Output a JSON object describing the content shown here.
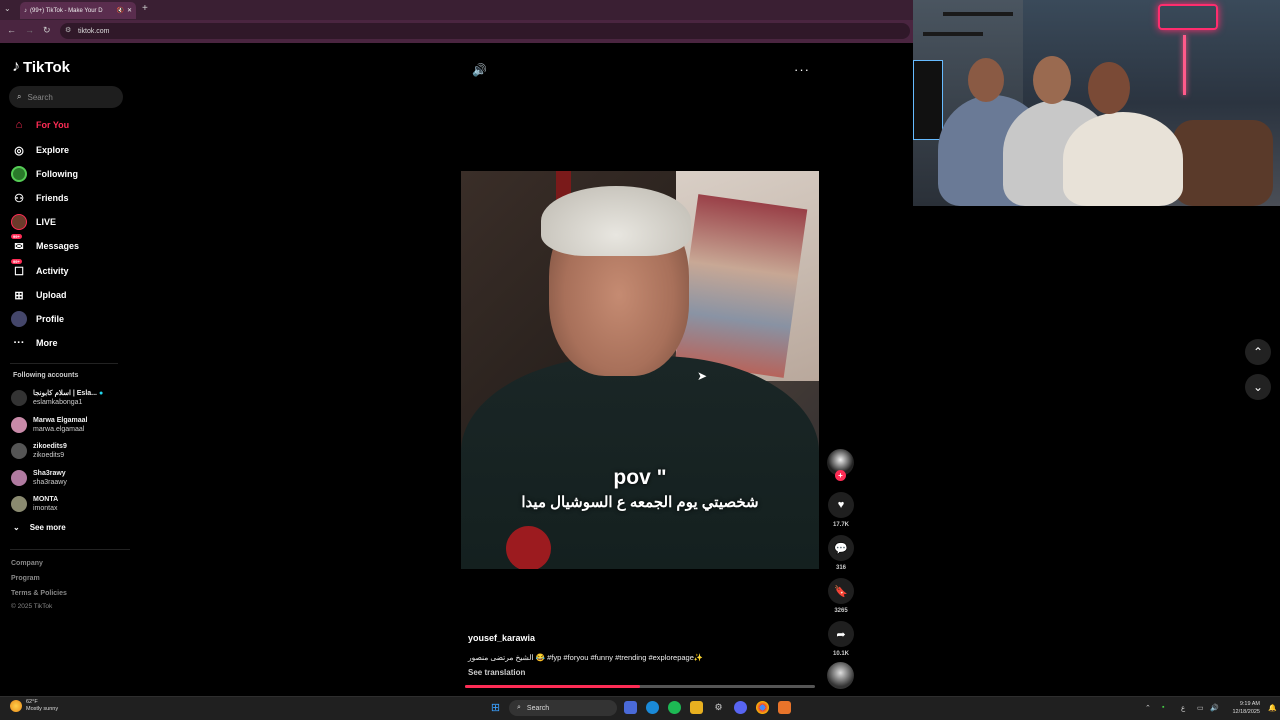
{
  "browser": {
    "tab_title": "(99+) TikTok - Make Your D",
    "url": "tiktok.com"
  },
  "sidebar": {
    "logo": "TikTok",
    "search_placeholder": "Search",
    "nav": [
      {
        "label": "For You",
        "icon": "home-icon",
        "active": true
      },
      {
        "label": "Explore",
        "icon": "compass-icon"
      },
      {
        "label": "Following",
        "icon": "following-icon"
      },
      {
        "label": "Friends",
        "icon": "friends-icon"
      },
      {
        "label": "LIVE",
        "icon": "live-icon"
      },
      {
        "label": "Messages",
        "icon": "messages-icon",
        "badge": "99+"
      },
      {
        "label": "Activity",
        "icon": "activity-icon",
        "badge": "99+"
      },
      {
        "label": "Upload",
        "icon": "upload-icon"
      },
      {
        "label": "Profile",
        "icon": "profile-icon"
      },
      {
        "label": "More",
        "icon": "more-icon"
      }
    ],
    "following_header": "Following accounts",
    "accounts": [
      {
        "name": "اسلام كابونجا | Esla...",
        "handle": "eslamkabonga1",
        "verified": true
      },
      {
        "name": "Marwa Elgamaal",
        "handle": "marwa.elgamaal"
      },
      {
        "name": "zikoedits9",
        "handle": "zikoedits9"
      },
      {
        "name": "Sha3rawy",
        "handle": "sha3raawy"
      },
      {
        "name": "MONTA",
        "handle": "imontax"
      }
    ],
    "see_more": "See more",
    "footer": {
      "company": "Company",
      "program": "Program",
      "terms": "Terms & Policies",
      "copyright": "© 2025 TikTok"
    }
  },
  "video": {
    "caption_line1": "pov \"",
    "caption_line2": "شخصيتي يوم الجمعه ع السوشيال ميدا",
    "username": "yousef_karawia",
    "description": "الشيخ مرتضى منصور 😂 #fyp #foryou #funny #trending #explorepage✨",
    "see_translation": "See translation",
    "progress": 0.5
  },
  "actions": {
    "likes": "17.7K",
    "comments": "316",
    "saves": "3265",
    "shares": "10.1K"
  },
  "taskbar": {
    "weather_temp": "62°F",
    "weather_desc": "Mostly sunny",
    "search": "Search",
    "time": "9:19 AM",
    "date": "12/18/2025",
    "lang": "ع"
  },
  "colors": {
    "accent": "#fe2c55",
    "background": "#000000",
    "taskbar": "#202020"
  }
}
